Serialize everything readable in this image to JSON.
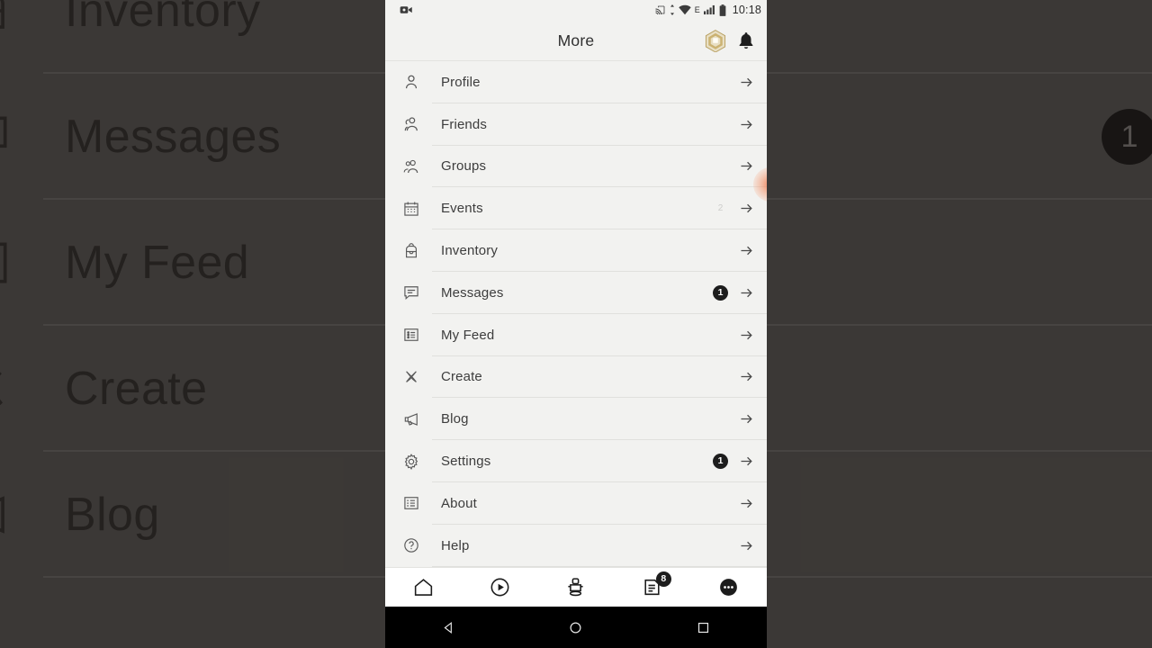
{
  "statusbar": {
    "time": "10:18",
    "network_type": "E",
    "icons": [
      "video-record-icon",
      "cast-icon",
      "data-transfer-icon",
      "wifi-icon",
      "signal-icon",
      "battery-icon"
    ]
  },
  "header": {
    "title": "More",
    "robux_icon": "robux-hexagon-icon",
    "robux_color": "#c9b077",
    "notification_icon": "bell-icon"
  },
  "menu": {
    "items": [
      {
        "label": "Profile",
        "icon": "person-icon",
        "badge": "",
        "badge_style": "none",
        "chevron": "arrow-right-icon"
      },
      {
        "label": "Friends",
        "icon": "friends-icon",
        "badge": "",
        "badge_style": "none",
        "chevron": "arrow-right-icon"
      },
      {
        "label": "Groups",
        "icon": "groups-icon",
        "badge": "",
        "badge_style": "none",
        "chevron": "arrow-right-icon"
      },
      {
        "label": "Events",
        "icon": "calendar-icon",
        "badge": "2",
        "badge_style": "ghost",
        "chevron": "arrow-right-icon"
      },
      {
        "label": "Inventory",
        "icon": "backpack-icon",
        "badge": "",
        "badge_style": "none",
        "chevron": "arrow-right-icon"
      },
      {
        "label": "Messages",
        "icon": "message-icon",
        "badge": "1",
        "badge_style": "dark",
        "chevron": "arrow-right-icon"
      },
      {
        "label": "My Feed",
        "icon": "feed-list-icon",
        "badge": "",
        "badge_style": "none",
        "chevron": "arrow-right-icon"
      },
      {
        "label": "Create",
        "icon": "create-icon",
        "badge": "",
        "badge_style": "none",
        "chevron": "arrow-right-icon"
      },
      {
        "label": "Blog",
        "icon": "megaphone-icon",
        "badge": "",
        "badge_style": "none",
        "chevron": "arrow-right-icon"
      },
      {
        "label": "Settings",
        "icon": "gear-icon",
        "badge": "1",
        "badge_style": "dark",
        "chevron": "arrow-right-icon"
      },
      {
        "label": "About",
        "icon": "about-icon",
        "badge": "",
        "badge_style": "none",
        "chevron": "arrow-right-icon"
      },
      {
        "label": "Help",
        "icon": "help-icon",
        "badge": "",
        "badge_style": "none",
        "chevron": "arrow-right-icon"
      }
    ]
  },
  "tabbar": {
    "tabs": [
      {
        "name": "home",
        "icon": "home-icon",
        "badge": ""
      },
      {
        "name": "games",
        "icon": "play-circle-icon",
        "badge": ""
      },
      {
        "name": "avatar",
        "icon": "avatar-icon",
        "badge": ""
      },
      {
        "name": "feed",
        "icon": "feed-doc-icon",
        "badge": "8"
      },
      {
        "name": "more",
        "icon": "more-dots-icon",
        "badge": ""
      }
    ]
  },
  "androidnav": {
    "buttons": [
      {
        "name": "back",
        "icon": "triangle-back-icon"
      },
      {
        "name": "home",
        "icon": "circle-home-icon"
      },
      {
        "name": "recents",
        "icon": "square-recents-icon"
      }
    ]
  },
  "background": {
    "overlay_color": "#4a4744",
    "rows": [
      {
        "label": "Inventory",
        "icon": "backpack-icon",
        "badge": ""
      },
      {
        "label": "Messages",
        "icon": "message-icon",
        "badge": "1"
      },
      {
        "label": "My Feed",
        "icon": "feed-list-icon",
        "badge": ""
      },
      {
        "label": "Create",
        "icon": "create-icon",
        "badge": ""
      },
      {
        "label": "Blog",
        "icon": "megaphone-icon",
        "badge": ""
      }
    ]
  },
  "touch_indicator": {
    "name": "tap-ripple",
    "color": "#ec6a3e"
  }
}
